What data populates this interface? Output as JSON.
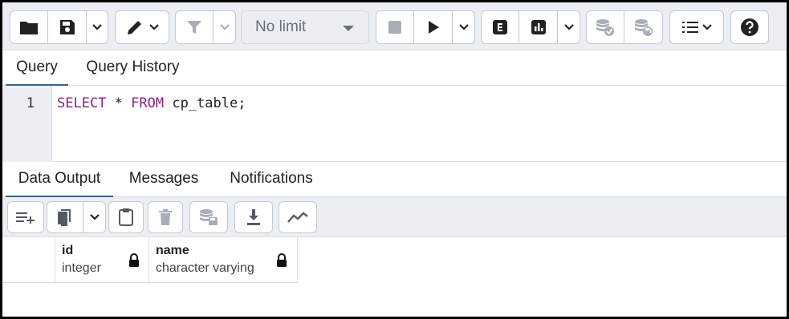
{
  "toolbar": {
    "buttons": [
      {
        "name": "open-file",
        "icon": "folder-icon"
      },
      {
        "name": "save-file",
        "icon": "floppy-disk-icon"
      },
      {
        "name": "save-options",
        "icon": "chevron-down-icon"
      },
      {
        "name": "edit",
        "icon": "pencil-icon"
      },
      {
        "name": "filter",
        "icon": "filter-icon"
      },
      {
        "name": "filter-options",
        "icon": "chevron-down-icon"
      },
      {
        "name": "stop",
        "icon": "stop-icon"
      },
      {
        "name": "execute",
        "icon": "play-icon"
      },
      {
        "name": "execute-options",
        "icon": "chevron-down-icon"
      },
      {
        "name": "explain",
        "icon": "explain-e-icon"
      },
      {
        "name": "explain-analyze",
        "icon": "bar-chart-icon"
      },
      {
        "name": "explain-options",
        "icon": "chevron-down-icon"
      },
      {
        "name": "commit",
        "icon": "database-check-icon"
      },
      {
        "name": "rollback",
        "icon": "database-undo-icon"
      },
      {
        "name": "macros",
        "icon": "list-icon"
      },
      {
        "name": "help",
        "icon": "question-icon"
      }
    ],
    "limit": {
      "selected": "No limit"
    }
  },
  "query_tabs": {
    "items": [
      {
        "label": "Query",
        "active": true
      },
      {
        "label": "Query History",
        "active": false
      }
    ]
  },
  "editor": {
    "line_number": "1",
    "tokens": {
      "select": "SELECT",
      "star": " * ",
      "from": "FROM",
      "rest": " cp_table;"
    },
    "keyword_color": "#8a1f8a"
  },
  "output_tabs": {
    "items": [
      {
        "label": "Data Output",
        "active": true
      },
      {
        "label": "Messages",
        "active": false
      },
      {
        "label": "Notifications",
        "active": false
      }
    ]
  },
  "data_toolbar": {
    "buttons": [
      {
        "name": "add-row",
        "icon": "add-row-icon"
      },
      {
        "name": "copy",
        "icon": "copy-icon"
      },
      {
        "name": "copy-options",
        "icon": "chevron-down-icon"
      },
      {
        "name": "paste",
        "icon": "clipboard-icon"
      },
      {
        "name": "delete",
        "icon": "trash-icon"
      },
      {
        "name": "save-data",
        "icon": "database-save-icon"
      },
      {
        "name": "download",
        "icon": "download-icon"
      },
      {
        "name": "graph",
        "icon": "line-graph-icon"
      }
    ]
  },
  "grid": {
    "columns": [
      {
        "name": "id",
        "type": "integer",
        "icon": "lock-icon"
      },
      {
        "name": "name",
        "type": "character varying",
        "icon": "lock-icon"
      }
    ]
  },
  "colors": {
    "toolbar_bg": "#ebeef3",
    "active_tab_underline": "#326690",
    "frame_border": "#000000"
  }
}
